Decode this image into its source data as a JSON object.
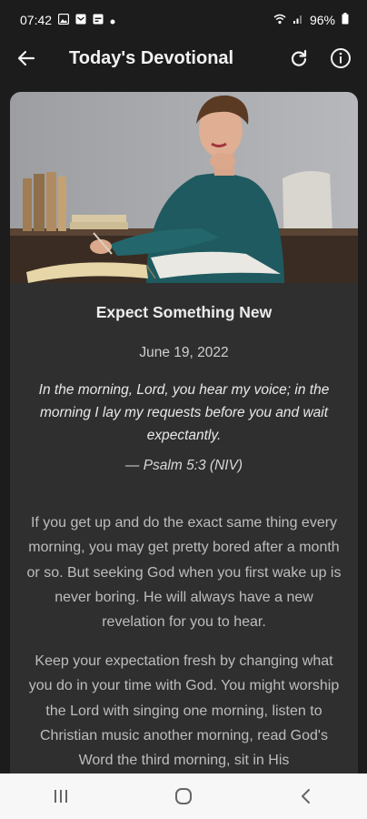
{
  "status_bar": {
    "time": "07:42",
    "battery": "96%",
    "icons": [
      "image-notification-icon",
      "mail-notification-icon",
      "calendar-notification-icon",
      "dot-icon",
      "wifi-icon",
      "signal-icon",
      "battery-icon"
    ]
  },
  "app_bar": {
    "title": "Today's Devotional",
    "back_icon": "back-arrow-icon",
    "refresh_icon": "refresh-icon",
    "info_icon": "info-icon"
  },
  "devotional": {
    "title": "Expect Something New",
    "date": "June 19, 2022",
    "verse": "In the morning, Lord, you hear my voice; in the morning I lay my requests before you and wait expectantly.",
    "verse_reference": "— Psalm 5:3 (NIV)",
    "paragraph_1": "If you get up and do the exact same thing every morning, you may get pretty bored after a month or so. But seeking God when you first wake up is never boring. He will always have a new revelation for you to hear.",
    "paragraph_2": "Keep your expectation fresh by changing what you do in your time with God. You might worship the Lord with singing one morning, listen to Christian music another morning, read God's Word the third morning, sit in His"
  },
  "nav_bar": {
    "recents_icon": "recents-icon",
    "home_icon": "home-icon",
    "back_icon": "nav-back-icon"
  },
  "colors": {
    "background": "#1c1c1c",
    "card": "#2f2f2f",
    "nav_bar": "#f7f7f7"
  }
}
